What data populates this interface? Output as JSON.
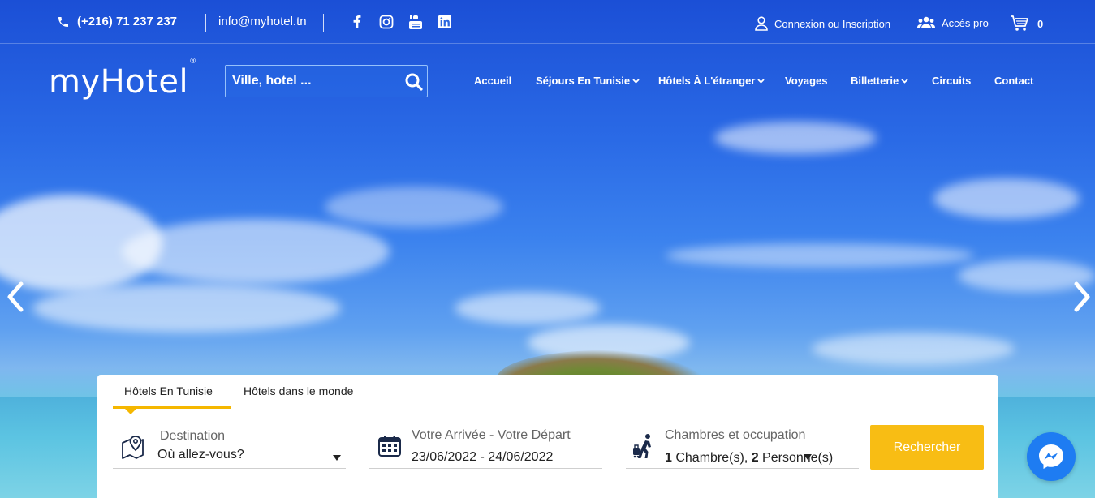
{
  "topbar": {
    "phone": "(+216) 71 237 237",
    "email": "info@myhotel.tn",
    "social": [
      "facebook-icon",
      "instagram-icon",
      "youtube-icon",
      "linkedin-icon"
    ],
    "login_label": "Connexion ou Inscription",
    "pro_label": "Accés pro",
    "cart_count": "0"
  },
  "logo": {
    "text": "myHotel",
    "mark": "®"
  },
  "search": {
    "placeholder": "Ville, hotel ..."
  },
  "nav": {
    "items": [
      {
        "label": "Accueil",
        "dropdown": false
      },
      {
        "label": "Séjours En Tunisie",
        "dropdown": true
      },
      {
        "label": "Hôtels À L'étranger",
        "dropdown": true
      },
      {
        "label": "Voyages",
        "dropdown": false
      },
      {
        "label": "Billetterie",
        "dropdown": true
      },
      {
        "label": "Circuits",
        "dropdown": false
      },
      {
        "label": "Contact",
        "dropdown": false
      }
    ]
  },
  "booking": {
    "tabs": [
      {
        "label": "Hôtels En Tunisie",
        "active": true
      },
      {
        "label": "Hôtels dans le monde",
        "active": false
      }
    ],
    "destination": {
      "label": "Destination",
      "value": "Où allez-vous?"
    },
    "dates": {
      "label": "Votre Arrivée - Votre Départ",
      "value": "23/06/2022 - 24/06/2022"
    },
    "occupancy": {
      "label": "Chambres et occupation",
      "rooms": "1",
      "rooms_suffix": " Chambre(s), ",
      "persons": "2",
      "persons_suffix": " Personne(s)"
    },
    "submit_label": "Rechercher"
  },
  "colors": {
    "accent": "#f8bd14",
    "messenger": "#1e7cf2",
    "icon_navy": "#1b2a4a"
  }
}
